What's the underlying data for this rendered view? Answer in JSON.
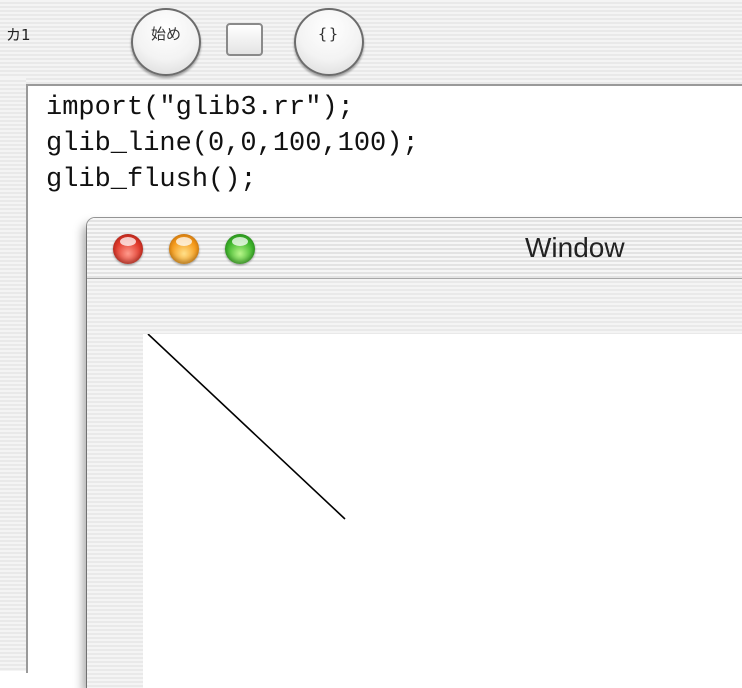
{
  "toolbar": {
    "label": "カ1",
    "start_button": "始め",
    "brace_button": "{}"
  },
  "editor": {
    "lines": [
      "import(\"glib3.rr\");",
      "glib_line(0,0,100,100);",
      "glib_flush();"
    ]
  },
  "window": {
    "title": "Window"
  }
}
